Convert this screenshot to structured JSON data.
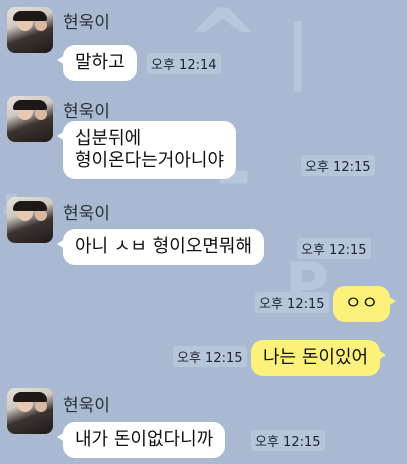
{
  "messages": [
    {
      "sender": "현욱이",
      "text": "말하고",
      "time": "오후 12:14",
      "direction": "in"
    },
    {
      "sender": "현욱이",
      "text_line1": "십분뒤에",
      "text_line2": "형이온다는거아니야",
      "time": "오후 12:15",
      "direction": "in"
    },
    {
      "sender": "현욱이",
      "text": "아니 ㅅㅂ 형이오면뭐해",
      "time": "오후 12:15",
      "direction": "in"
    },
    {
      "text": "ㅇㅇ",
      "time": "오후 12:15",
      "direction": "out"
    },
    {
      "text": "나는 돈이있어",
      "time": "오후 12:15",
      "direction": "out"
    },
    {
      "sender": "현욱이",
      "text": "내가 돈이없다니까",
      "time": "오후 12:15",
      "direction": "in"
    }
  ],
  "colors": {
    "background": "#a9b9d2",
    "incoming_bubble": "#ffffff",
    "outgoing_bubble": "#fcf17a"
  }
}
